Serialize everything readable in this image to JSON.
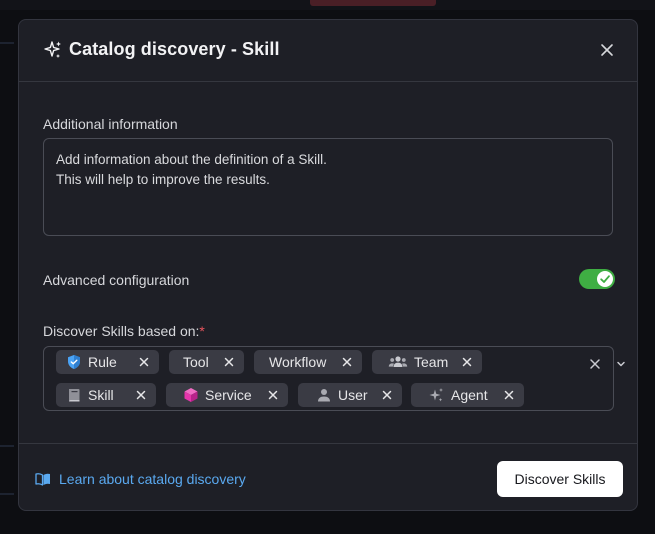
{
  "dialog": {
    "title": "Catalog discovery - Skill"
  },
  "form": {
    "additional_label": "Additional information",
    "additional_placeholder": "Add information about the definition of a Skill.\nThis will help to improve the results.",
    "advanced_label": "Advanced configuration",
    "advanced_enabled": true,
    "discover_label": "Discover Skills based on:",
    "required_mark": "*"
  },
  "chips": [
    {
      "label": "Rule",
      "icon": "shield-icon"
    },
    {
      "label": "Tool",
      "icon": ""
    },
    {
      "label": "Workflow",
      "icon": ""
    },
    {
      "label": "Team",
      "icon": "team-icon"
    },
    {
      "label": "Skill",
      "icon": "book-icon"
    },
    {
      "label": "Service",
      "icon": "cube-icon"
    },
    {
      "label": "User",
      "icon": "user-icon"
    },
    {
      "label": "Agent",
      "icon": "sparkle-icon"
    }
  ],
  "footer": {
    "learn_link": "Learn about catalog discovery",
    "discover_button": "Discover Skills"
  },
  "colors": {
    "toggle_on": "#3fae43",
    "link": "#5aa9f0",
    "required": "#e8555e",
    "service_icon": "#e535ab",
    "rule_icon": "#4aa3f5"
  }
}
